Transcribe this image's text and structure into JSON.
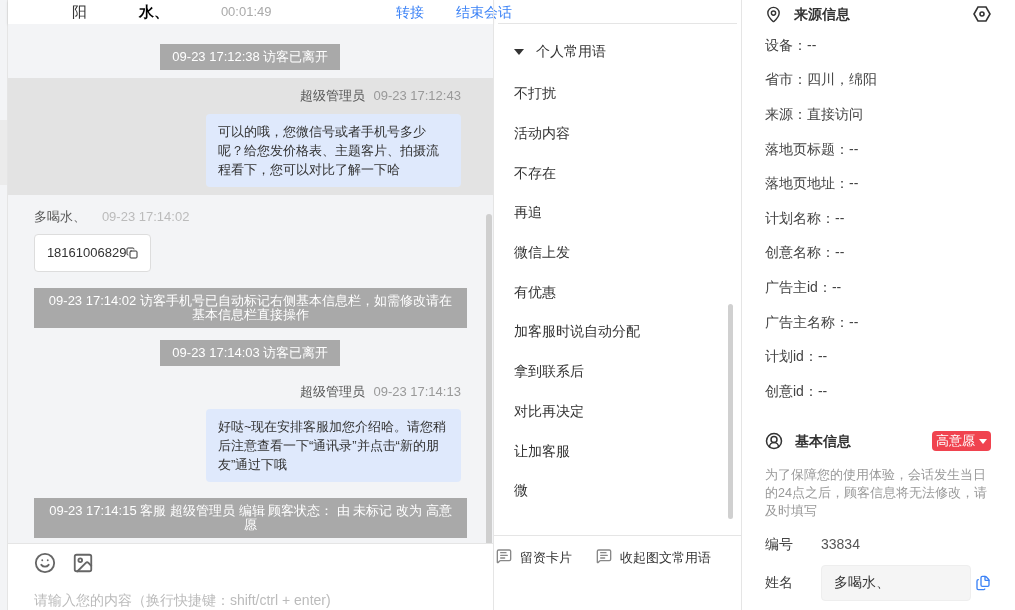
{
  "header": {
    "items": [
      "阳",
      "水、",
      "00:01:49"
    ],
    "actions": [
      "转接",
      "结束会话"
    ]
  },
  "messages": [
    {
      "kind": "notice",
      "text": "09-23 17:12:38 访客已离开",
      "highlighted": false
    },
    {
      "kind": "agent",
      "sender": "超级管理员",
      "time": "09-23 17:12:43",
      "text": "可以的哦，您微信号或者手机号多少呢？给您发价格表、主题客片、拍摄流程看下，您可以对比了解一下哈",
      "highlighted": true
    },
    {
      "kind": "visitor",
      "sender": "多喝水、",
      "time": "09-23 17:14:02",
      "text": "18161006829",
      "highlighted": false
    },
    {
      "kind": "notice",
      "text": "09-23 17:14:02 访客手机号已自动标记右侧基本信息栏，如需修改请在基本信息栏直接操作",
      "highlighted": false
    },
    {
      "kind": "notice",
      "text": "09-23 17:14:03 访客已离开",
      "highlighted": false
    },
    {
      "kind": "agent",
      "sender": "超级管理员",
      "time": "09-23 17:14:13",
      "text": "好哒~现在安排客服加您介绍哈。请您稍后注意查看一下“通讯录”并点击“新的朋友”通过下哦",
      "highlighted": false
    },
    {
      "kind": "notice",
      "text": "09-23 17:14:15 客服 超级管理员 编辑 顾客状态： 由 未标记 改为 高意愿",
      "highlighted": false
    }
  ],
  "input": {
    "placeholder": "请输入您的内容（换行快捷键：shift/ctrl + enter)"
  },
  "phrases": {
    "section": "个人常用语",
    "expanded": true,
    "items": [
      "不打扰",
      "活动内容",
      "不存在",
      "再追",
      "微信上发",
      "有优惠",
      "加客服时说自动分配",
      "拿到联系后",
      "对比再决定",
      "让加客服",
      "微"
    ]
  },
  "toolbar": [
    "留资卡片",
    "收起图文常用语"
  ],
  "source_info": {
    "title": "来源信息",
    "fields": [
      "设备：--",
      "省市：四川，绵阳",
      "来源：直接访问",
      "落地页标题：--",
      "落地页地址：--",
      "计划名称：--",
      "创意名称：--",
      "广告主id：--",
      "广告主名称：--",
      "计划id：--",
      "创意id：--"
    ]
  },
  "basic_info": {
    "title": "基本信息",
    "status": "高意愿",
    "note": "为了保障您的使用体验，会话发生当日的24点之后，顾客信息将无法修改，请及时填写",
    "fields": [
      {
        "label": "编号",
        "value": "33834",
        "kind": "text"
      },
      {
        "label": "姓名",
        "value": "多喝水、",
        "kind": "input"
      }
    ]
  }
}
